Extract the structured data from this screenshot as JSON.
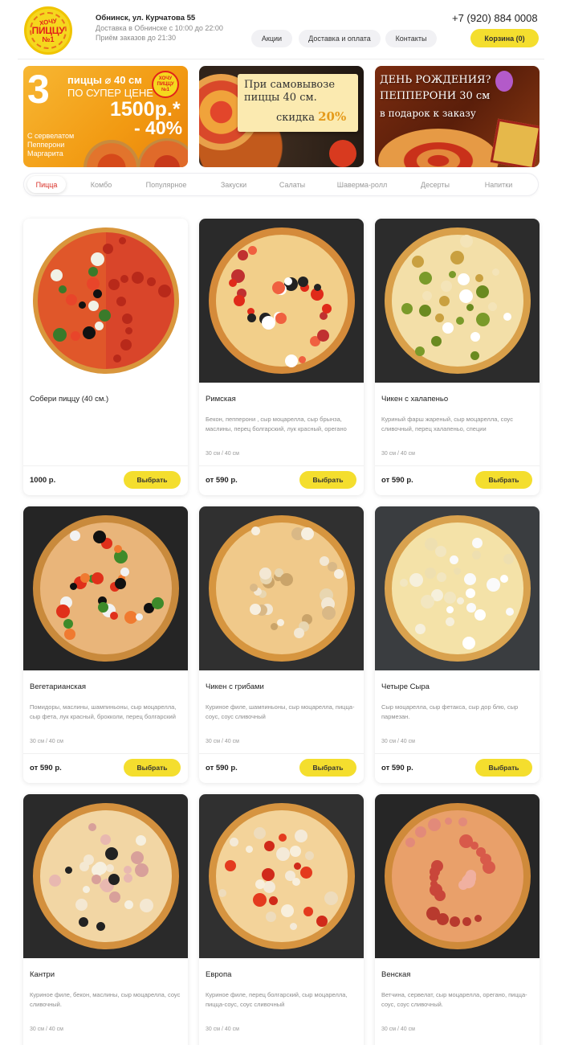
{
  "header": {
    "logo": {
      "line1": "ХОЧУ",
      "line2": "ПИЦЦУ",
      "line3": "№1"
    },
    "address": "Обнинск, ул. Курчатова 55",
    "delivery_info": "Доставка в Обнинске с 10:00 до 22:00",
    "order_hours": "Приём заказов до 21:30",
    "phone": "+7 (920) 884 0008",
    "nav": [
      "Акции",
      "Доставка и оплата",
      "Контакты"
    ],
    "cart_label": "Корзина (0)"
  },
  "banners": {
    "b1": {
      "big_number": "3",
      "line1": "пиццы ⌀ 40 см",
      "line2": "ПО СУПЕР ЦЕНЕ",
      "price": "1500р.*",
      "discount": "- 40%",
      "sub1": "С сервелатом",
      "sub2": "Пепперони",
      "sub3": "Маргарита",
      "logo_text": "ХОЧУ ПИЦЦУ №1"
    },
    "b2": {
      "line1": "При самовывозе",
      "line2": "пиццы 40 см.",
      "line3": "скидка",
      "discount": "20%"
    },
    "b3": {
      "line1": "ДЕНЬ РОЖДЕНИЯ?",
      "line2": "ПЕППЕРОНИ 30 см",
      "line3": "в подарок к заказу"
    }
  },
  "categories": {
    "active": "Пицца",
    "items": [
      "Пицца",
      "Комбо",
      "Популярное",
      "Закуски",
      "Салаты",
      "Шаверма-ролл",
      "Десерты",
      "Напитки"
    ]
  },
  "products": [
    {
      "name": "Собери пиццу (40 см.)",
      "description": "",
      "sizes": "",
      "price": "1000 р.",
      "button": "Выбрать",
      "photo_style": "half-half"
    },
    {
      "name": "Римская",
      "description": "Бекон, пепперони , сыр моцарелла, сыр брынза, маслины, перец болгарский, лук красный, орегано",
      "sizes": "30 см / 40 см",
      "price": "от 590 р.",
      "button": "Выбрать",
      "photo_style": "peppers"
    },
    {
      "name": "Чикен с халапеньо",
      "description": "Куриный фарш жареный, сыр моцарелла, соус сливочный, перец халапеньо, специи",
      "sizes": "30 см / 40 см",
      "price": "от 590 р.",
      "button": "Выбрать",
      "photo_style": "jalapeno"
    },
    {
      "name": "Вегетарианская",
      "description": "Помидоры, маслины, шампиньоны, сыр моцарелла, сыр фета, лук красный, брокколи, перец болгарский",
      "sizes": "30 см / 40 см",
      "price": "от 590 р.",
      "button": "Выбрать",
      "photo_style": "veggie"
    },
    {
      "name": "Чикен с грибами",
      "description": "Куриное филе, шампиньоны, сыр моцарелла, пицца-соус, соус сливочный",
      "sizes": "30 см / 40 см",
      "price": "от 590 р.",
      "button": "Выбрать",
      "photo_style": "mushroom"
    },
    {
      "name": "Четыре Сыра",
      "description": "Сыр моцарелла, сыр фетакса, сыр дор блю, сыр пармезан.",
      "sizes": "30 см / 40 см",
      "price": "от 590 р.",
      "button": "Выбрать",
      "photo_style": "cheese"
    },
    {
      "name": "Кантри",
      "description": "Куриное филе, бекон, маслины, сыр моцарелла, соус сливочный.",
      "sizes": "30 см / 40 см",
      "price": "",
      "button": "",
      "photo_style": "country"
    },
    {
      "name": "Европа",
      "description": "Куриное филе, перец болгарский, сыр моцарелла, пицца-соус, соус сливочный",
      "sizes": "30 см / 40 см",
      "price": "",
      "button": "",
      "photo_style": "europe"
    },
    {
      "name": "Венская",
      "description": "Ветчина, сервелат, сыр моцарелла, орегано, пицца-соус, соус сливочный.",
      "sizes": "30 см / 40 см",
      "price": "",
      "button": "",
      "photo_style": "salami"
    }
  ],
  "colors": {
    "accent_yellow": "#f4de2e",
    "active_tab_red": "#d9322a",
    "muted_text": "#8c8c8c"
  }
}
